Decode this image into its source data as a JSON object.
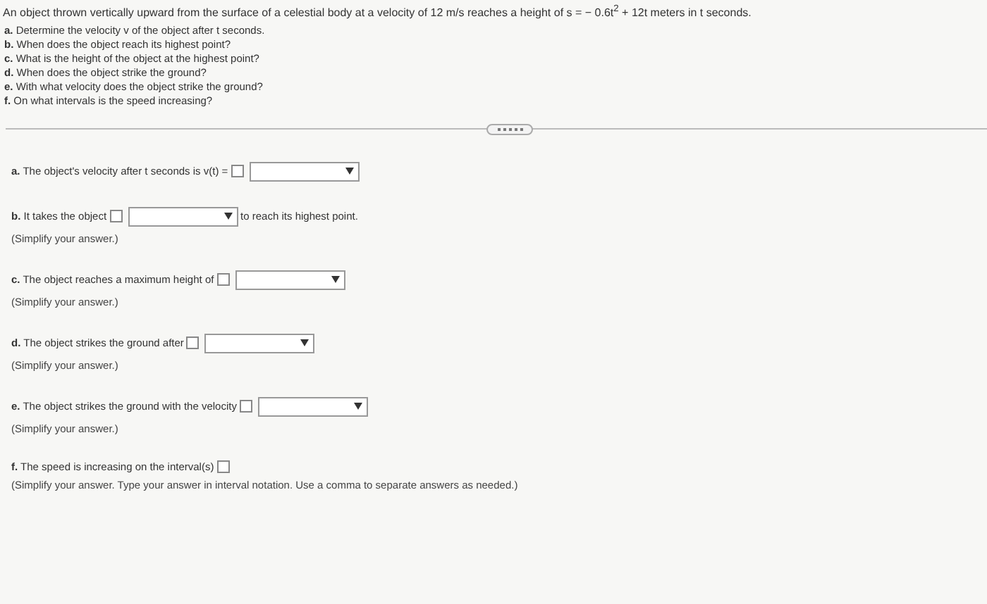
{
  "problem": "An object thrown vertically upward from the surface of a celestial body at a velocity of 12 m/s reaches a height of s = − 0.6t$^{2}$ + 12t meters in t seconds.",
  "questions": [
    "**a.** Determine the velocity v of the object after t seconds.",
    "**b.** When does the object reach its highest point?",
    "**c.** What is the height of the object at the highest point?",
    "**d.** When does the object strike the ground?",
    "**e.** With what velocity does the object strike the ground?",
    "**f.** On what intervals is the speed increasing?"
  ],
  "answers": [
    {
      "label": "**a.** The object's velocity after t seconds is v(t) =",
      "dropdown": true
    },
    {
      "label": "**b.** It takes the object",
      "dropdown": true,
      "suffix": "to reach its highest point.",
      "hint": "(Simplify your answer.)"
    },
    {
      "label": "**c.** The object reaches a maximum height of",
      "dropdown": true,
      "hint": "(Simplify your answer.)"
    },
    {
      "label": "**d.** The object strikes the ground after",
      "dropdown": true,
      "hint": "(Simplify your answer.)"
    },
    {
      "label": "**e.** The object strikes the ground with the velocity",
      "dropdown": true,
      "hint": "(Simplify your answer.)"
    },
    {
      "label": "**f.** The speed is increasing on the interval(s)",
      "dropdown": false,
      "hint": "(Simplify your answer. Type your answer in interval notation. Use a comma to separate answers as needed.)"
    }
  ]
}
